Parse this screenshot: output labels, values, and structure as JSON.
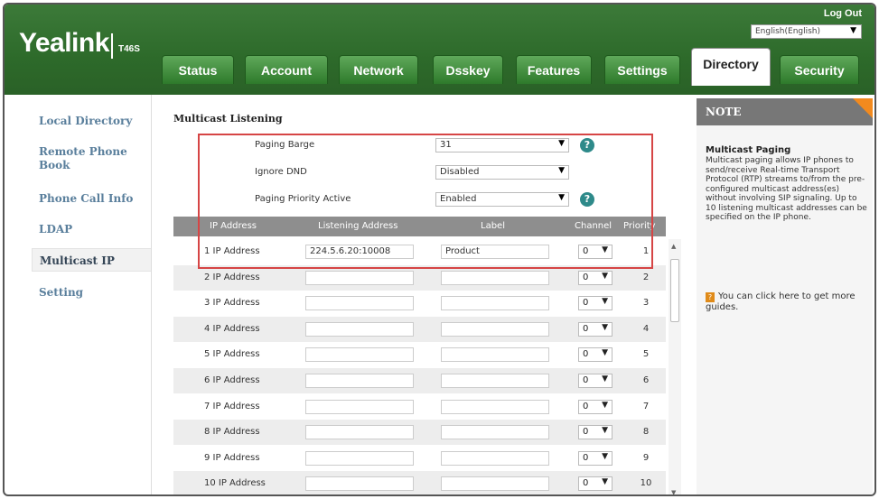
{
  "header": {
    "brand": "Yealink",
    "model": "T46S",
    "logout": "Log Out",
    "language": "English(English)"
  },
  "tabs": [
    {
      "label": "Status"
    },
    {
      "label": "Account"
    },
    {
      "label": "Network"
    },
    {
      "label": "Dsskey"
    },
    {
      "label": "Features"
    },
    {
      "label": "Settings"
    },
    {
      "label": "Directory",
      "active": true
    },
    {
      "label": "Security"
    }
  ],
  "sidebar": {
    "items": [
      {
        "label": "Local Directory"
      },
      {
        "label": "Remote Phone Book"
      },
      {
        "label": "Phone Call Info"
      },
      {
        "label": "LDAP"
      },
      {
        "label": "Multicast IP",
        "active": true
      },
      {
        "label": "Setting"
      }
    ]
  },
  "main": {
    "section_title": "Multicast Listening",
    "paging_barge": {
      "label": "Paging Barge",
      "value": "31"
    },
    "ignore_dnd": {
      "label": "Ignore DND",
      "value": "Disabled"
    },
    "paging_priority": {
      "label": "Paging Priority Active",
      "value": "Enabled"
    },
    "columns": [
      "IP Address",
      "Listening Address",
      "Label",
      "Channel",
      "Priority"
    ],
    "rows": [
      {
        "name": "1 IP Address",
        "address": "224.5.6.20:10008",
        "label": "Product",
        "channel": "0",
        "priority": "1"
      },
      {
        "name": "2 IP Address",
        "address": "",
        "label": "",
        "channel": "0",
        "priority": "2"
      },
      {
        "name": "3 IP Address",
        "address": "",
        "label": "",
        "channel": "0",
        "priority": "3"
      },
      {
        "name": "4 IP Address",
        "address": "",
        "label": "",
        "channel": "0",
        "priority": "4"
      },
      {
        "name": "5 IP Address",
        "address": "",
        "label": "",
        "channel": "0",
        "priority": "5"
      },
      {
        "name": "6 IP Address",
        "address": "",
        "label": "",
        "channel": "0",
        "priority": "6"
      },
      {
        "name": "7 IP Address",
        "address": "",
        "label": "",
        "channel": "0",
        "priority": "7"
      },
      {
        "name": "8 IP Address",
        "address": "",
        "label": "",
        "channel": "0",
        "priority": "8"
      },
      {
        "name": "9 IP Address",
        "address": "",
        "label": "",
        "channel": "0",
        "priority": "9"
      },
      {
        "name": "10 IP Address",
        "address": "",
        "label": "",
        "channel": "0",
        "priority": "10"
      }
    ]
  },
  "note": {
    "heading": "NOTE",
    "title": "Multicast Paging",
    "body": "Multicast paging allows IP phones to send/receive Real-time Transport Protocol (RTP) streams to/from the pre-configured multicast address(es) without involving SIP signaling. Up to 10 listening multicast addresses can be specified on the IP phone.",
    "guide": "You can click here to get more guides."
  },
  "colors": {
    "header_green": "#2d6a2a",
    "tab_green": "#3d8a39",
    "highlight_red": "#d64545",
    "note_header": "#777777",
    "note_corner": "#f28a1e",
    "help_icon": "#2e8a8a"
  },
  "icons": {
    "help": "question-circle-icon",
    "dropdown": "chevron-down-icon",
    "guide": "guide-book-icon"
  }
}
